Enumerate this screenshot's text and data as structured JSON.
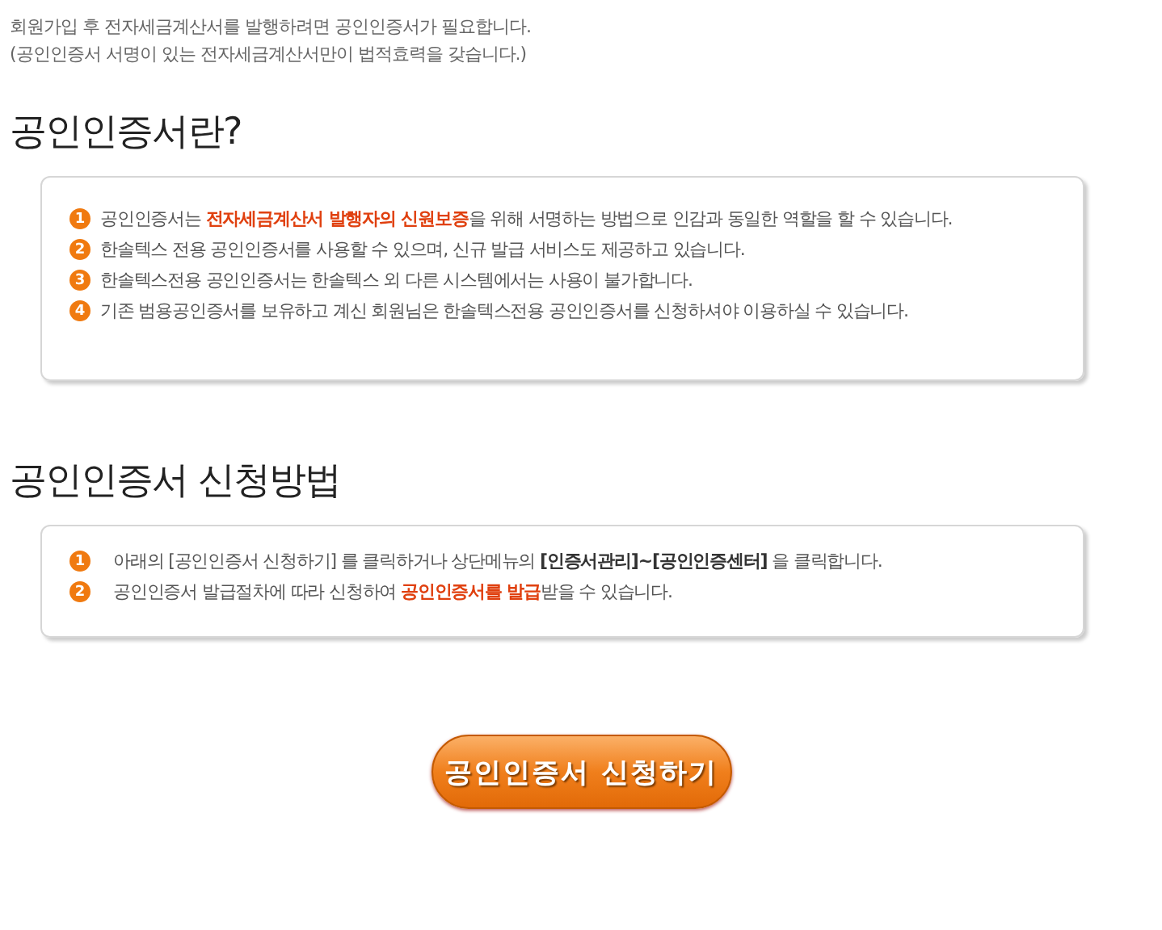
{
  "intro": [
    "회원가입 후 전자세금계산서를 발행하려면 공인인증서가 필요합니다.",
    "(공인인증서 서명이 있는 전자세금계산서만이 법적효력을 갖습니다.)"
  ],
  "sections": [
    {
      "heading": "공인인증서란?",
      "items": [
        {
          "number": "1",
          "text": "공인인증서는 **전자세금계산서 발행자의 신원보증**을 위해 서명하는 방법으로 인감과 동일한 역할을 할 수 있습니다.",
          "color": "#e0400f"
        },
        {
          "number": "2",
          "text": "한솔텍스 전용 공인인증서를 사용할 수 있으며, 신규 발급 서비스도 제공하고 있습니다."
        },
        {
          "number": "3",
          "text": "한솔텍스전용 공인인증서는  한솔텍스  외 다른 시스템에서는 사용이 불가합니다."
        },
        {
          "number": "4",
          "text": "기존 범용공인증서를 보유하고 계신 회원님은 한솔텍스전용 공인인증서를 신청하셔야  이용하실 수 있습니다."
        }
      ]
    },
    {
      "heading": "공인인증서 신청방법",
      "items": [
        {
          "number": "1",
          "text": "아래의 [공인인증서 신청하기] 를 클릭하거나 상단메뉴의  **[인증서관리]~[공인인증센터]** 을 클릭합니다.",
          "color": "#333333"
        },
        {
          "number": "2",
          "text": "공인인증서 발급절차에 따라 신청하여 **공인인증서를 발급**받을 수 있습니다.",
          "color": "#e0400f"
        }
      ]
    }
  ],
  "button": {
    "label": "공인인증서 신청하기"
  }
}
